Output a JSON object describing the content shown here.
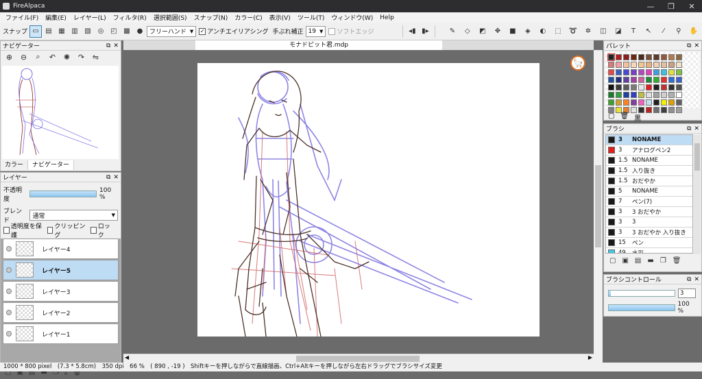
{
  "window": {
    "title": "FireAlpaca",
    "min": "—",
    "max": "❐",
    "close": "✕"
  },
  "menu": [
    "ファイル(F)",
    "編集(E)",
    "レイヤー(L)",
    "フィルタ(R)",
    "選択範囲(S)",
    "スナップ(N)",
    "カラー(C)",
    "表示(V)",
    "ツール(T)",
    "ウィンドウ(W)",
    "Help"
  ],
  "toolbar": {
    "snap_label": "スナップ",
    "brush_mode": "フリーハンド",
    "antialias_label": "アンチエイリアシング",
    "stabilizer_label": "手ぶれ補正",
    "stabilizer_value": "19",
    "soft_edge_label": "ソフトエッジ"
  },
  "navigator": {
    "title": "ナビゲーター",
    "tabs": [
      "カラー",
      "ナビゲーター"
    ],
    "active_tab": "ナビゲーター"
  },
  "layers": {
    "title": "レイヤー",
    "opacity_label": "不透明度",
    "opacity_value": "100 %",
    "opacity_fraction": 1.0,
    "blend_label": "ブレンド",
    "blend_value": "通常",
    "preserve_label": "透明度を保護",
    "clipping_label": "クリッピング",
    "lock_label": "ロック",
    "items": [
      {
        "name": "レイヤー4",
        "selected": false
      },
      {
        "name": "レイヤー5",
        "selected": true
      },
      {
        "name": "レイヤー3",
        "selected": false
      },
      {
        "name": "レイヤー2",
        "selected": false
      },
      {
        "name": "レイヤー1",
        "selected": false
      }
    ]
  },
  "document": {
    "tab_title": "モナドピット君.mdp"
  },
  "palette": {
    "title": "パレット",
    "current_color_name": "黒",
    "colors": [
      "#222222",
      "#b02020",
      "#8a1f1f",
      "#6b2a10",
      "#4d2a20",
      "#7a4f3a",
      "#5b3b2a",
      "#915a3a",
      "#b37a50",
      "#8c6a40",
      "#d97a7a",
      "#f0a0a0",
      "#f5c0a0",
      "#f7d7b5",
      "#f3c690",
      "#e8b07a",
      "#f0d0b0",
      "#e3bfa0",
      "#c9a080",
      "#f2e2c8",
      "#e24a4a",
      "#3b5fbf",
      "#4a4ad0",
      "#7a3fbf",
      "#b04ac0",
      "#e040c0",
      "#3fa0e0",
      "#40c0e0",
      "#e0e040",
      "#80c040",
      "#2050a0",
      "#203080",
      "#6040a0",
      "#a040a0",
      "#d060a0",
      "#1a8a3a",
      "#30b030",
      "#e03030",
      "#2f6fcf",
      "#4060d0",
      "#101010",
      "#3a3a3a",
      "#5a5a5a",
      "#7a7a7a",
      "#e8e8e8",
      "#e02020",
      "#202020",
      "#c03030",
      "#303030",
      "#505050",
      "#1a7a2a",
      "#30a040",
      "#2040a0",
      "#3040c0",
      "#c0c040",
      "#e0e0e0",
      "#a0a0a0",
      "#d0d0d0",
      "#b0b0b0",
      "#ffffff",
      "#40a030",
      "#d0a030",
      "#ff8020",
      "#8040a0",
      "#f060c0",
      "#c0e0f0",
      "#202020",
      "#f0f000",
      "#e0a000",
      "#606060",
      "#808080",
      "#f0e030",
      "#e08030",
      "#e0e0e0",
      "#303030",
      "#c02020",
      "#707070",
      "#404040",
      "#909090",
      "#a0a0a0"
    ]
  },
  "brushes": {
    "title": "ブラシ",
    "items": [
      {
        "size": "3",
        "name": "NONAME",
        "color": "#1a1a1a",
        "selected": true
      },
      {
        "size": "3",
        "name": "アナログペン2",
        "color": "#e02020",
        "selected": false
      },
      {
        "size": "1.5",
        "name": "NONAME",
        "color": "#1a1a1a",
        "selected": false
      },
      {
        "size": "1.5",
        "name": "入り抜き",
        "color": "#1a1a1a",
        "selected": false
      },
      {
        "size": "1.5",
        "name": "おだやか",
        "color": "#1a1a1a",
        "selected": false
      },
      {
        "size": "5",
        "name": "NONAME",
        "color": "#1a1a1a",
        "selected": false
      },
      {
        "size": "7",
        "name": "ペン(7)",
        "color": "#1a1a1a",
        "selected": false
      },
      {
        "size": "3",
        "name": "3 おだやか",
        "color": "#1a1a1a",
        "selected": false
      },
      {
        "size": "3",
        "name": "3",
        "color": "#1a1a1a",
        "selected": false
      },
      {
        "size": "3",
        "name": "3 おだやか 入り抜き",
        "color": "#1a1a1a",
        "selected": false
      },
      {
        "size": "15",
        "name": "ペン",
        "color": "#1a1a1a",
        "selected": false
      },
      {
        "size": "49",
        "name": "水彩",
        "color": "#40c8e8",
        "selected": false
      }
    ]
  },
  "brush_control": {
    "title": "ブラシコントロール",
    "size_value": "3",
    "size_fraction": 0.03,
    "opacity_value": "100 %",
    "opacity_fraction": 1.0
  },
  "status": "1000 * 800 pixel　(7.3 * 5.8cm)　350 dpi　66 %　( 890 , -19 )　Shiftキーを押しながらで直線描画、Ctrl+Altキーを押しながら左右ドラッグでブラシサイズ変更"
}
